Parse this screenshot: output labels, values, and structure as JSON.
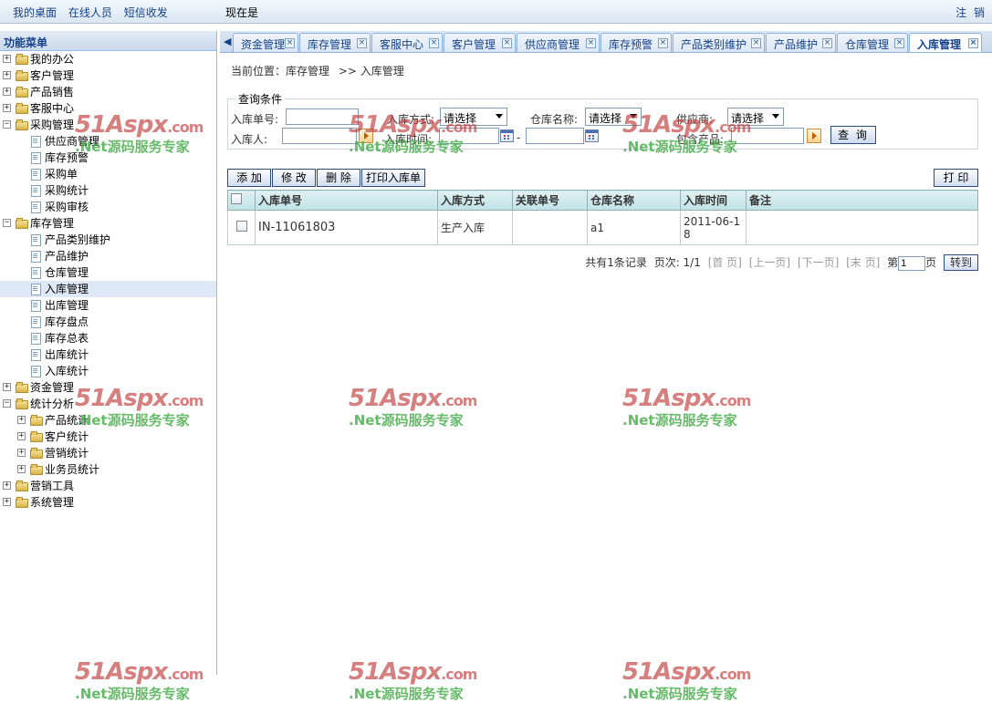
{
  "topbar": {
    "links": [
      "我的桌面",
      "在线人员",
      "短信收发"
    ],
    "now_label": "现在是",
    "logout": "注 销"
  },
  "sidebar": {
    "title": "功能菜单",
    "items": [
      {
        "label": "我的办公",
        "level": 0,
        "expanded": false
      },
      {
        "label": "客户管理",
        "level": 0,
        "expanded": false
      },
      {
        "label": "产品销售",
        "level": 0,
        "expanded": false
      },
      {
        "label": "客服中心",
        "level": 0,
        "expanded": false
      },
      {
        "label": "采购管理",
        "level": 0,
        "expanded": true
      },
      {
        "label": "供应商管理",
        "level": 1
      },
      {
        "label": "库存预警",
        "level": 1
      },
      {
        "label": "采购单",
        "level": 1
      },
      {
        "label": "采购统计",
        "level": 1
      },
      {
        "label": "采购审核",
        "level": 1
      },
      {
        "label": "库存管理",
        "level": 0,
        "expanded": true
      },
      {
        "label": "产品类别维护",
        "level": 1
      },
      {
        "label": "产品维护",
        "level": 1
      },
      {
        "label": "仓库管理",
        "level": 1
      },
      {
        "label": "入库管理",
        "level": 1,
        "selected": true
      },
      {
        "label": "出库管理",
        "level": 1
      },
      {
        "label": "库存盘点",
        "level": 1
      },
      {
        "label": "库存总表",
        "level": 1
      },
      {
        "label": "出库统计",
        "level": 1
      },
      {
        "label": "入库统计",
        "level": 1
      },
      {
        "label": "资金管理",
        "level": 0,
        "expanded": false
      },
      {
        "label": "统计分析",
        "level": 0,
        "expanded": true
      },
      {
        "label": "产品统计",
        "level": 1,
        "expandable": true
      },
      {
        "label": "客户统计",
        "level": 1,
        "expandable": true
      },
      {
        "label": "营销统计",
        "level": 1,
        "expandable": true
      },
      {
        "label": "业务员统计",
        "level": 1,
        "expandable": true
      },
      {
        "label": "营销工具",
        "level": 0,
        "expanded": false
      },
      {
        "label": "系统管理",
        "level": 0,
        "expanded": false
      }
    ]
  },
  "tabs": [
    "资金管理",
    "库存管理",
    "客服中心",
    "客户管理",
    "供应商管理",
    "库存预警",
    "产品类别维护",
    "产品维护",
    "仓库管理",
    "入库管理"
  ],
  "active_tab": "入库管理",
  "breadcrumb": [
    "当前位置：库存管理",
    ">> 入库管理"
  ],
  "query": {
    "legend": "查询条件",
    "receipt_no_label": "入库单号:",
    "receipt_type_label": "入库方式:",
    "receipt_type_value": "请选择",
    "warehouse_label": "仓库名称:",
    "warehouse_value": "请选择",
    "supplier_label": "供应商:",
    "supplier_value": "请选择",
    "person_label": "入库人:",
    "time_label": "入库时间:",
    "time_sep": "-",
    "product_label": "包含产品:",
    "search_button": "查 询"
  },
  "toolbar": {
    "add": "添 加",
    "edit": "修 改",
    "delete": "删 除",
    "print_receipt": "打印入库单",
    "print": "打 印"
  },
  "grid": {
    "columns": [
      "入库单号",
      "入库方式",
      "关联单号",
      "仓库名称",
      "入库时间",
      "备注"
    ],
    "rows": [
      {
        "receipt_no": "IN-11061803",
        "type": "生产入库",
        "ref": "",
        "warehouse": "a1",
        "time": "2011-06-18",
        "remark": ""
      }
    ]
  },
  "pager": {
    "total": "共有1条记录",
    "pages": "页次: 1/1",
    "first": "[首 页]",
    "prev": "[上一页]",
    "next": "[下一页]",
    "last": "[末 页]",
    "goto_prefix": "第",
    "page_input": "1",
    "goto_suffix": "页",
    "goto_button": "转到"
  },
  "watermark": {
    "brand": "51Aspx",
    "domain": ".com",
    "slogan": ".Net源码服务专家"
  },
  "colors": {
    "accent": "#15428b",
    "selected": "#dfe8f6",
    "grid_header": "#bfe2e6",
    "watermark_red": "#c13b3b",
    "watermark_green": "#4caf50"
  }
}
